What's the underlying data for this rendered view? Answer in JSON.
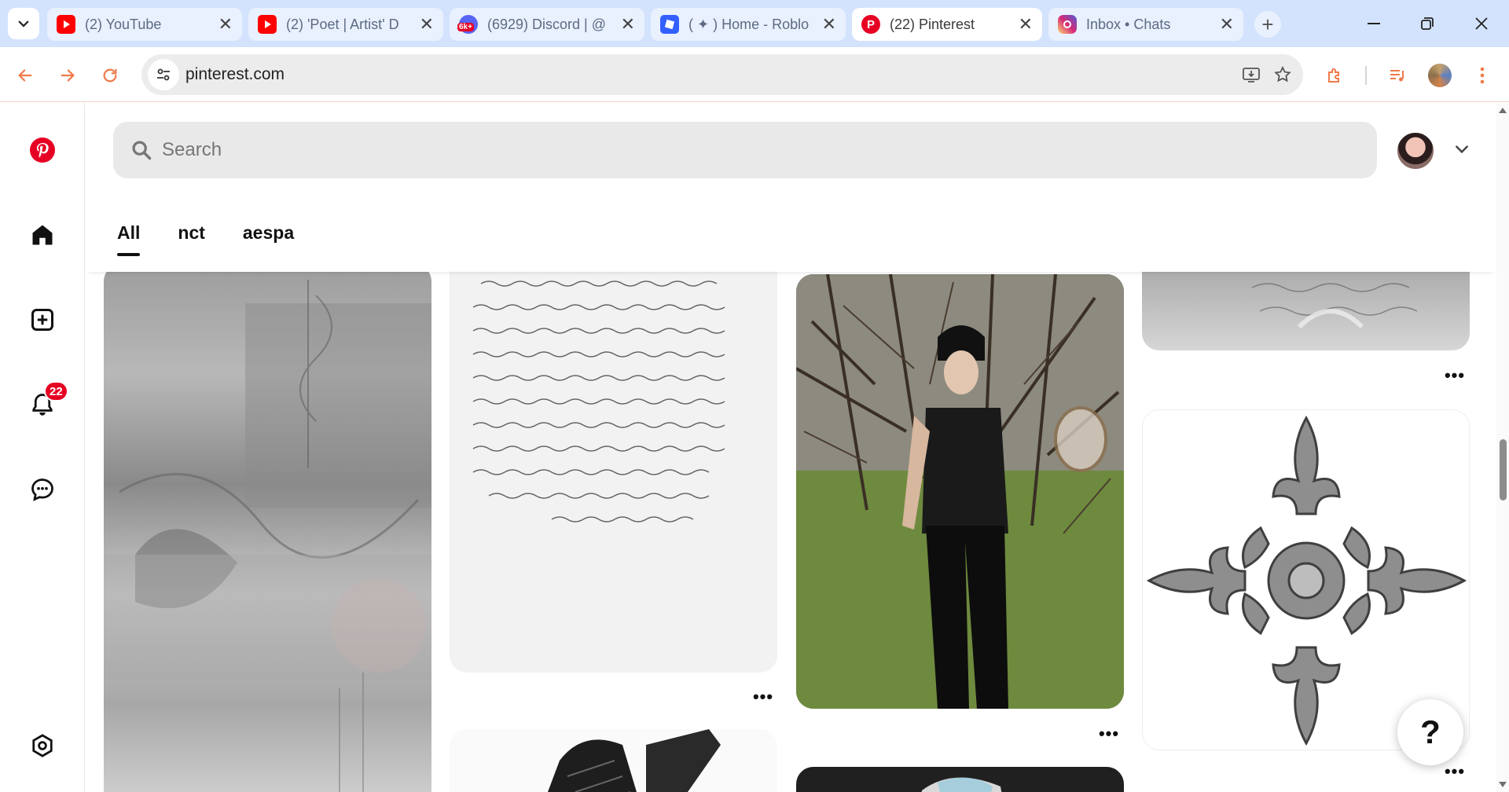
{
  "browser": {
    "tabs": [
      {
        "title": "(2) YouTube",
        "icon": "youtube-icon",
        "color": "#ff0000",
        "active": false
      },
      {
        "title": "(2) 'Poet | Artist' D",
        "icon": "youtube-icon",
        "color": "#ff0000",
        "active": false
      },
      {
        "title": "(6929) Discord | @",
        "icon": "discord-icon",
        "color": "#5865f2",
        "badge": "6k+",
        "active": false
      },
      {
        "title": "( ✦ ) Home - Roblo",
        "icon": "roblox-icon",
        "color": "#335fff",
        "active": false
      },
      {
        "title": "(22) Pinterest",
        "icon": "pinterest-icon",
        "color": "#e60023",
        "active": true
      },
      {
        "title": "Inbox • Chats",
        "icon": "instagram-icon",
        "color": "#d6249f",
        "active": false
      }
    ],
    "url": "pinterest.com",
    "accent_color": "#f07a4a"
  },
  "sidebar": {
    "notification_count": "22"
  },
  "header": {
    "search_placeholder": "Search",
    "feed_tabs": [
      "All",
      "nct",
      "aespa"
    ]
  },
  "help_label": "?",
  "pin_more_label": "•••"
}
